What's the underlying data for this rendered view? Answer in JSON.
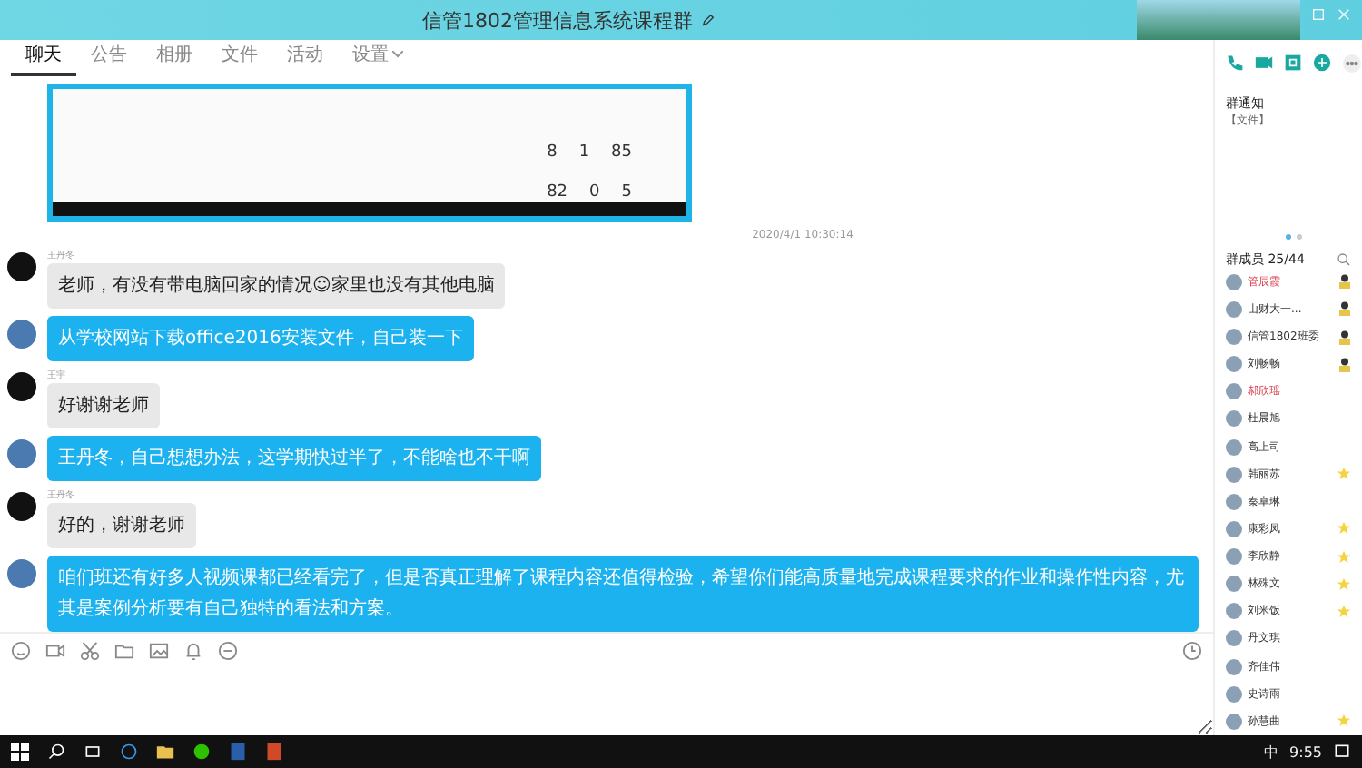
{
  "window": {
    "title": "信管1802管理信息系统课程群"
  },
  "tabs": [
    {
      "label": "聊天",
      "selected": true
    },
    {
      "label": "公告",
      "selected": false
    },
    {
      "label": "相册",
      "selected": false
    },
    {
      "label": "文件",
      "selected": false
    },
    {
      "label": "活动",
      "selected": false
    },
    {
      "label": "设置",
      "selected": false,
      "dropdown": true
    }
  ],
  "shared_screenshot": {
    "stats": [
      [
        "8",
        "1",
        "85"
      ],
      [
        "82",
        "0",
        "5"
      ]
    ]
  },
  "timestamp": "2020/4/1 10:30:14",
  "messages": [
    {
      "kind": "received",
      "sender": "王丹冬",
      "text": "老师，有没有带电脑回家的情况☺家里也没有其他电脑"
    },
    {
      "kind": "sent",
      "text": "从学校网站下载office2016安装文件，自己装一下"
    },
    {
      "kind": "received",
      "sender": "王宇",
      "text": "好谢谢老师"
    },
    {
      "kind": "sent",
      "text": "王丹冬，自己想想办法，这学期快过半了，不能啥也不干啊"
    },
    {
      "kind": "received",
      "sender": "王丹冬",
      "text": "好的，谢谢老师"
    },
    {
      "kind": "sent",
      "text": "咱们班还有好多人视频课都已经看完了，但是否真正理解了课程内容还值得检验，希望你们能高质量地完成课程要求的作业和操作性内容，尤其是案例分析要有自己独特的看法和方案。"
    }
  ],
  "notice": {
    "title": "群通知",
    "tag": "【文件】"
  },
  "members_header": "群成员 25/44",
  "members": [
    {
      "name": "管辰霞",
      "highlighted": true,
      "kind": "admin"
    },
    {
      "name": "山财大一...",
      "highlighted": false,
      "kind": "admin"
    },
    {
      "name": "信管1802班委",
      "highlighted": false,
      "kind": "admin"
    },
    {
      "name": "刘畅畅",
      "highlighted": false,
      "kind": "admin"
    },
    {
      "name": "郝欣瑶",
      "highlighted": true,
      "kind": "member"
    },
    {
      "name": "杜晨旭",
      "highlighted": false,
      "kind": "member"
    },
    {
      "name": "高上司",
      "highlighted": false,
      "kind": "member"
    },
    {
      "name": "韩丽苏",
      "highlighted": false,
      "kind": "starred"
    },
    {
      "name": "秦卓琳",
      "highlighted": false,
      "kind": "member"
    },
    {
      "name": "康彩凤",
      "highlighted": false,
      "kind": "starred"
    },
    {
      "name": "李欣静",
      "highlighted": false,
      "kind": "starred"
    },
    {
      "name": "林殊文",
      "highlighted": false,
      "kind": "starred"
    },
    {
      "name": "刘米饭",
      "highlighted": false,
      "kind": "starred"
    },
    {
      "name": "丹文琪",
      "highlighted": false,
      "kind": "member"
    },
    {
      "name": "齐佳伟",
      "highlighted": false,
      "kind": "member"
    },
    {
      "name": "史诗雨",
      "highlighted": false,
      "kind": "member"
    },
    {
      "name": "孙慧曲",
      "highlighted": false,
      "kind": "starred"
    }
  ],
  "taskbar": {
    "ime": "中",
    "time": "9:55"
  }
}
